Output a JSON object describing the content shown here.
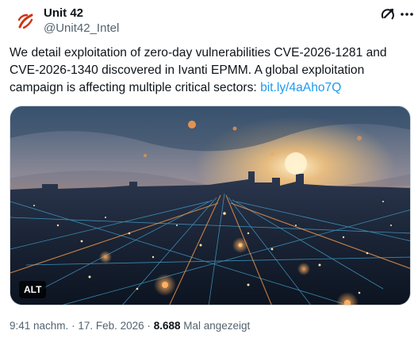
{
  "author": {
    "name": "Unit 42",
    "handle": "@Unit42_Intel",
    "avatar_icon": "unit42-logo-icon"
  },
  "header_icons": [
    "grok-icon",
    "more-icon"
  ],
  "tweet": {
    "text_before_link": "We detail exploitation of zero-day vulnerabilities CVE-2026-1281 and CVE-2026-1340 discovered in Ivanti EPMM. A global exploitation campaign is affecting multiple critical sectors: ",
    "link_text": "bit.ly/4aAho7Q"
  },
  "media": {
    "alt_badge": "ALT"
  },
  "meta": {
    "time": "9:41 nachm.",
    "separator1": "·",
    "date": "17. Feb. 2026",
    "separator2": "·",
    "views_count": "8.688",
    "views_label": "Mal angezeigt"
  },
  "colors": {
    "link": "#1d9bf0",
    "logo_red": "#d13212",
    "secondary_text": "#536471"
  }
}
